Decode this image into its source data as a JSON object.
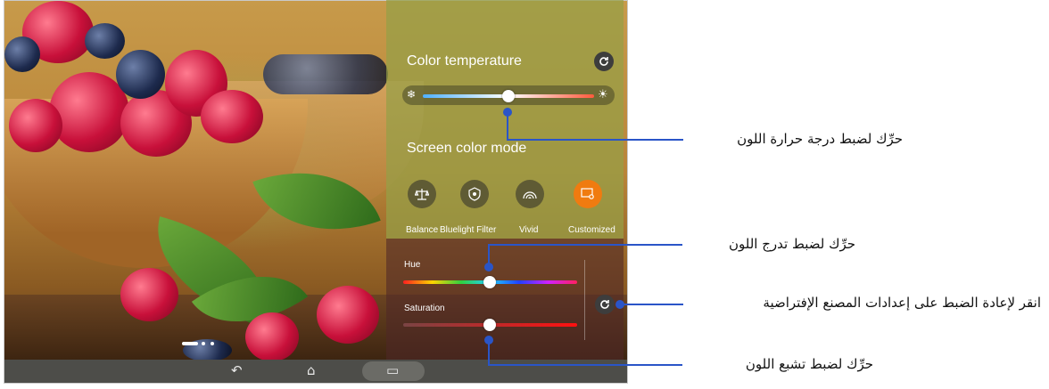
{
  "panel": {
    "color_temperature_title": "Color temperature",
    "screen_color_mode_title": "Screen color mode",
    "temperature_cold_icon": "❄",
    "temperature_warm_icon": "☀",
    "modes": [
      {
        "label": "Balance",
        "icon": "balance-scale-icon"
      },
      {
        "label": "Bluelight Filter",
        "icon": "eye-filter-icon"
      },
      {
        "label": "Vivid",
        "icon": "rainbow-icon"
      },
      {
        "label": "Customized",
        "icon": "custom-screen-icon",
        "selected": true
      }
    ],
    "hue_label": "Hue",
    "saturation_label": "Saturation",
    "temperature_level": 0.5,
    "hue_level": 0.5,
    "saturation_level": 0.5,
    "accent_color": "#f07b10"
  },
  "callouts": {
    "temperature": "حرِّك لضبط درجة حرارة اللون",
    "hue": "حرِّك لضبط تدرج اللون",
    "reset": "انقر لإعادة الضبط على إعدادات المصنع الإفتراضية",
    "saturation": "حرِّك لضبط تشبع اللون",
    "line_color": "#2a55c8"
  },
  "navbar": {
    "back_icon": "↶",
    "home_icon": "⌂",
    "recents_icon": "▭"
  }
}
